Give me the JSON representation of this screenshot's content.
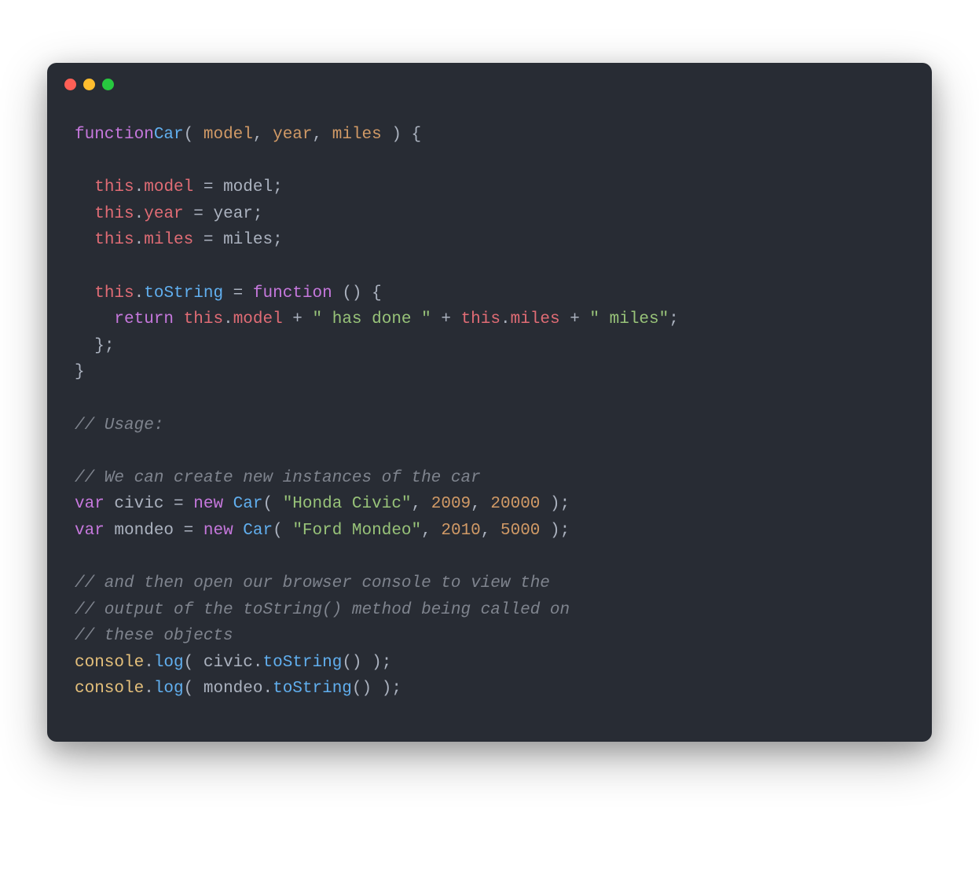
{
  "code": {
    "l1_function": "function",
    "l1_car": "Car",
    "l1_open": "( ",
    "l1_model": "model",
    "l1_c1": ", ",
    "l1_year": "year",
    "l1_c2": ", ",
    "l1_miles": "miles",
    "l1_close": " ) {",
    "blank": "",
    "l3_this": "this",
    "l3_dot": ".",
    "l3_model": "model",
    "l3_eq": " = ",
    "l3_model2": "model",
    "l3_semi": ";",
    "l4_this": "this",
    "l4_dot": ".",
    "l4_year": "year",
    "l4_eq": " = ",
    "l4_year2": "year",
    "l4_semi": ";",
    "l5_this": "this",
    "l5_dot": ".",
    "l5_miles": "miles",
    "l5_eq": " = ",
    "l5_miles2": "miles",
    "l5_semi": ";",
    "l7_this": "this",
    "l7_dot": ".",
    "l7_tostring": "toString",
    "l7_eq": " = ",
    "l7_function": "function",
    "l7_parens": " () {",
    "l8_return": "return",
    "l8_sp": " ",
    "l8_this": "this",
    "l8_dot": ".",
    "l8_model": "model",
    "l8_plus1": " + ",
    "l8_str1": "\" has done \"",
    "l8_plus2": " + ",
    "l8_this2": "this",
    "l8_dot2": ".",
    "l8_miles": "miles",
    "l8_plus3": " + ",
    "l8_str2": "\" miles\"",
    "l8_semi": ";",
    "l9_close": "};",
    "l10_close": "}",
    "c1": "// Usage:",
    "c2": "// We can create new instances of the car",
    "l14_var": "var",
    "l14_civic": " civic ",
    "l14_eq": "= ",
    "l14_new": "new",
    "l14_sp": " ",
    "l14_car": "Car",
    "l14_open": "( ",
    "l14_str": "\"Honda Civic\"",
    "l14_c1": ", ",
    "l14_n1": "2009",
    "l14_c2": ", ",
    "l14_n2": "20000",
    "l14_close": " );",
    "l15_var": "var",
    "l15_mondeo": " mondeo ",
    "l15_eq": "= ",
    "l15_new": "new",
    "l15_sp": " ",
    "l15_car": "Car",
    "l15_open": "( ",
    "l15_str": "\"Ford Mondeo\"",
    "l15_c1": ", ",
    "l15_n1": "2010",
    "l15_c2": ", ",
    "l15_n2": "5000",
    "l15_close": " );",
    "c3": "// and then open our browser console to view the",
    "c4": "// output of the toString() method being called on",
    "c5": "// these objects",
    "l20_console": "console",
    "l20_dot": ".",
    "l20_log": "log",
    "l20_open": "( ",
    "l20_civic": "civic",
    "l20_dot2": ".",
    "l20_tostring": "toString",
    "l20_parens": "()",
    "l20_close": " );",
    "l21_console": "console",
    "l21_dot": ".",
    "l21_log": "log",
    "l21_open": "( ",
    "l21_mondeo": "mondeo",
    "l21_dot2": ".",
    "l21_tostring": "toString",
    "l21_parens": "()",
    "l21_close": " );"
  }
}
